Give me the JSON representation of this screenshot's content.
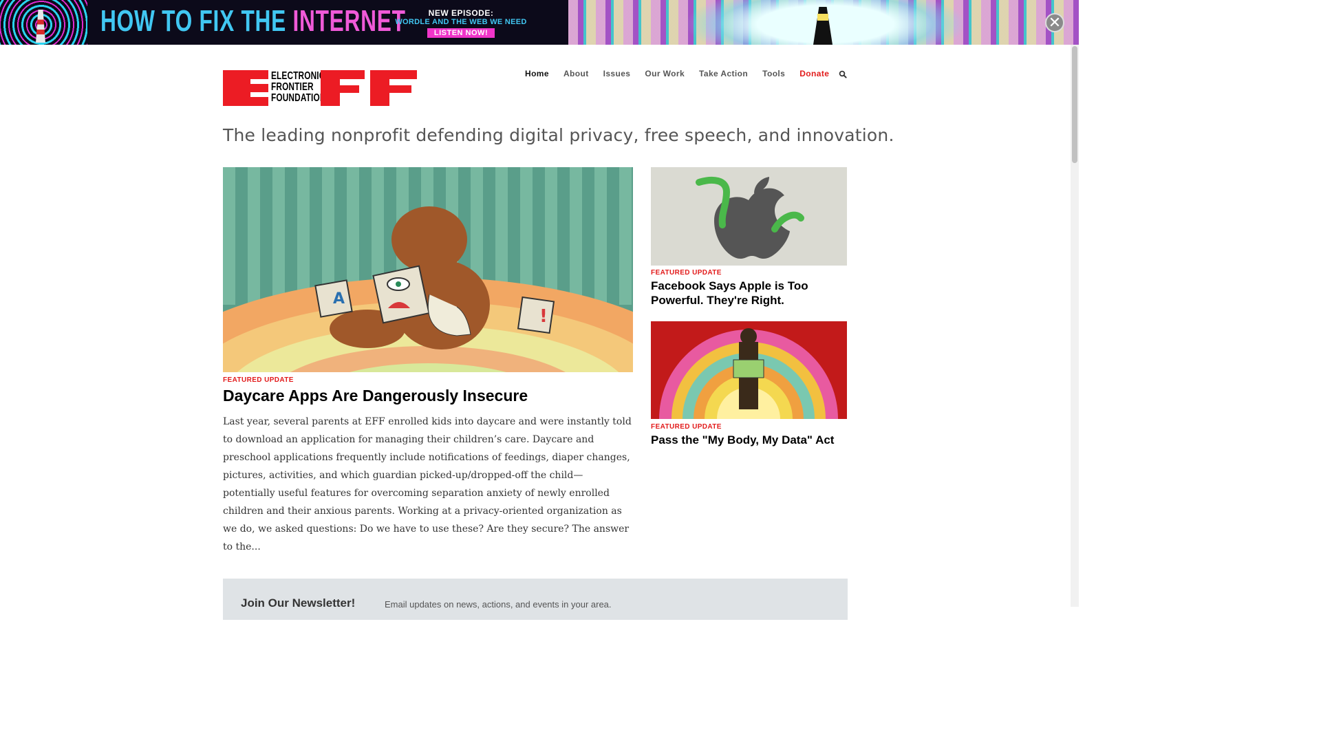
{
  "banner": {
    "title_part1": "HOW TO FIX THE ",
    "title_part2": "INTERNET",
    "episode_label": "NEW EPISODE:",
    "episode_title": "WORDLE AND THE WEB WE NEED",
    "listen_label": "LISTEN NOW!",
    "close_symbol": "✕",
    "accent_cyan": "#41c7f2",
    "accent_pink": "#f035c9"
  },
  "logo": {
    "line1": "ELECTRONIC",
    "line2": "FRONTIER",
    "line3": "FOUNDATION",
    "brand_color": "#ec1c24"
  },
  "nav": {
    "items": [
      "Home",
      "About",
      "Issues",
      "Our Work",
      "Take Action",
      "Tools"
    ],
    "donate": "Donate",
    "search_icon": "search-icon"
  },
  "tagline": "The leading nonprofit defending digital privacy, free speech, and innovation.",
  "main_feature": {
    "kicker": "FEATURED UPDATE",
    "title": "Daycare Apps Are Dangerously Insecure",
    "body": "Last year, several parents at EFF enrolled kids into daycare and were instantly told to download an application for managing their children’s care. Daycare and preschool applications frequently include notifications of feedings, diaper changes, pictures, activities, and which guardian picked-up/dropped-off the child—potentially useful features for overcoming separation anxiety of newly enrolled children and their anxious parents. Working at a privacy-oriented organization as we do, we asked questions: Do we have to use these? Are they secure? The answer to the..."
  },
  "side_features": [
    {
      "kicker": "FEATURED UPDATE",
      "title": "Facebook Says Apple is Too Powerful. They're Right."
    },
    {
      "kicker": "FEATURED UPDATE",
      "title": "Pass the \"My Body, My Data\" Act"
    }
  ],
  "newsletter": {
    "heading": "Join Our Newsletter!",
    "text": "Email updates on news, actions, and events in your area."
  }
}
